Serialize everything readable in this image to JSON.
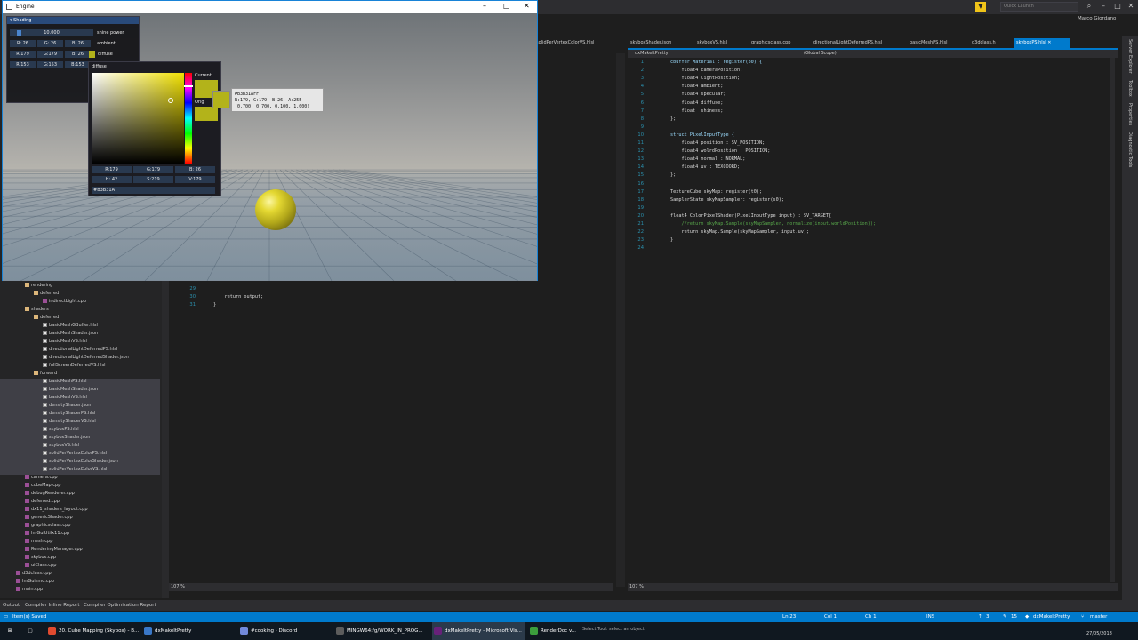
{
  "engine": {
    "title": "Engine",
    "imgui": {
      "window_title": "Shading",
      "shine_value": "10.000",
      "shine_label": "shine power",
      "ambient": {
        "r": "R: 26",
        "g": "G: 26",
        "b": "B: 26",
        "label": "ambient"
      },
      "diffuse": {
        "r": "R:179",
        "g": "G:179",
        "b": "B: 26",
        "label": "diffuse"
      },
      "specular": {
        "r": "R:153",
        "g": "G:153",
        "b": "B:153"
      },
      "picker": {
        "title": "diffuse",
        "current_label": "Current",
        "original_label": "Orig",
        "r": "R:179",
        "g": "G:179",
        "b": "B: 26",
        "h": "H: 42",
        "s": "S:219",
        "v": "V:179",
        "hex": "#B3B31A",
        "tooltip_line1": "#B3B31AFF",
        "tooltip_line2": "R:179, G:179, B:26, A:255",
        "tooltip_line3": "(0.700, 0.700, 0.100, 1.000)"
      }
    },
    "colors": {
      "diffuse": "#b3b31a",
      "ambient": "#1a1a1a",
      "specular": "#999999"
    }
  },
  "vs": {
    "quick_launch": "Quick Launch",
    "user": "Marco Giordano",
    "tabs_left": [
      "solidPerVertexColorVS.hlsl"
    ],
    "tabs_right": [
      "skyboxShader.json",
      "skyboxVS.hlsl",
      "graphicsclass.cpp",
      "directionalLightDeferredPS.hlsl",
      "basicMeshPS.hlsl",
      "d3dclass.h",
      "skyboxPS.hlsl"
    ],
    "nav_project": "dxMakeItPretty",
    "nav_scope": "(Global Scope)",
    "code_lines": [
      {
        "n": "1",
        "t": "cbuffer Material : register(b0) {"
      },
      {
        "n": "2",
        "t": "    float4 cameraPosition;"
      },
      {
        "n": "3",
        "t": "    float4 lightPosition;"
      },
      {
        "n": "4",
        "t": "    float4 ambient;"
      },
      {
        "n": "5",
        "t": "    float4 specular;"
      },
      {
        "n": "6",
        "t": "    float4 diffuse;"
      },
      {
        "n": "7",
        "t": "    float  shiness;"
      },
      {
        "n": "8",
        "t": "};"
      },
      {
        "n": "9",
        "t": ""
      },
      {
        "n": "10",
        "t": "struct PixelInputType {"
      },
      {
        "n": "11",
        "t": "    float4 position : SV_POSITION;"
      },
      {
        "n": "12",
        "t": "    float4 wolrdPosition : POSITION;"
      },
      {
        "n": "13",
        "t": "    float4 normal : NORMAL;"
      },
      {
        "n": "14",
        "t": "    float4 uv : TEXCOORD;"
      },
      {
        "n": "15",
        "t": "};"
      },
      {
        "n": "16",
        "t": ""
      },
      {
        "n": "17",
        "t": "TextureCube skyMap: register(t0);"
      },
      {
        "n": "18",
        "t": "SamplerState skyMapSampler: register(s0);"
      },
      {
        "n": "19",
        "t": ""
      },
      {
        "n": "20",
        "t": "float4 ColorPixelShader(PixelInputType input) : SV_TARGET{"
      },
      {
        "n": "21",
        "t": "    //return skyMap.Sample(skyMapSampler, normalize(input.worldPosition));"
      },
      {
        "n": "22",
        "t": "    return skyMap.Sample(skyMapSampler, input.uv);"
      },
      {
        "n": "23",
        "t": "}"
      },
      {
        "n": "24",
        "t": ""
      }
    ],
    "mid_lines": [
      {
        "n": "29",
        "t": ""
      },
      {
        "n": "30",
        "t": "    return output;"
      },
      {
        "n": "31",
        "t": "}"
      }
    ],
    "zoom_left": "107 %",
    "zoom_right": "107 %",
    "solution_tree": [
      {
        "label": "rendering",
        "kind": "folder",
        "level": 2
      },
      {
        "label": "deferred",
        "kind": "folder",
        "level": 3
      },
      {
        "label": "indirectLight.cpp",
        "kind": "cpp",
        "level": 4
      },
      {
        "label": "shaders",
        "kind": "folder",
        "level": 2
      },
      {
        "label": "deferred",
        "kind": "folder",
        "level": 3
      },
      {
        "label": "basicMeshGBuffer.hlsl",
        "kind": "file",
        "level": 4
      },
      {
        "label": "basicMeshShader.json",
        "kind": "file",
        "level": 4
      },
      {
        "label": "basicMeshVS.hlsl",
        "kind": "file",
        "level": 4
      },
      {
        "label": "directionalLightDeferredPS.hlsl",
        "kind": "file",
        "level": 4
      },
      {
        "label": "directionalLightDeferredShader.json",
        "kind": "file",
        "level": 4
      },
      {
        "label": "fullScreenDeferredVS.hlsl",
        "kind": "file",
        "level": 4
      },
      {
        "label": "forward",
        "kind": "folder",
        "level": 3
      },
      {
        "label": "basicMeshPS.hlsl",
        "kind": "file",
        "level": 4
      },
      {
        "label": "basicMeshShader.json",
        "kind": "file",
        "level": 4
      },
      {
        "label": "basicMeshVS.hlsl",
        "kind": "file",
        "level": 4
      },
      {
        "label": "densityShader.json",
        "kind": "file",
        "level": 4
      },
      {
        "label": "densityShaderPS.hlsl",
        "kind": "file",
        "level": 4
      },
      {
        "label": "densityShaderVS.hlsl",
        "kind": "file",
        "level": 4
      },
      {
        "label": "skyboxPS.hlsl",
        "kind": "file",
        "level": 4
      },
      {
        "label": "skyboxShader.json",
        "kind": "file",
        "level": 4
      },
      {
        "label": "skyboxVS.hlsl",
        "kind": "file",
        "level": 4
      },
      {
        "label": "solidPerVertexColorPS.hlsl",
        "kind": "file",
        "level": 4
      },
      {
        "label": "solidPerVertexColorShader.json",
        "kind": "file",
        "level": 4
      },
      {
        "label": "solidPerVertexColorVS.hlsl",
        "kind": "file",
        "level": 4
      },
      {
        "label": "camera.cpp",
        "kind": "cpp",
        "level": 2
      },
      {
        "label": "cubeMap.cpp",
        "kind": "cpp",
        "level": 2
      },
      {
        "label": "debugRenderer.cpp",
        "kind": "cpp",
        "level": 2
      },
      {
        "label": "deferred.cpp",
        "kind": "cpp",
        "level": 2
      },
      {
        "label": "dx11_shaders_layout.cpp",
        "kind": "cpp",
        "level": 2
      },
      {
        "label": "genericShader.cpp",
        "kind": "cpp",
        "level": 2
      },
      {
        "label": "graphicsclass.cpp",
        "kind": "cpp",
        "level": 2
      },
      {
        "label": "ImGuiUtilx11.cpp",
        "kind": "cpp",
        "level": 2
      },
      {
        "label": "mesh.cpp",
        "kind": "cpp",
        "level": 2
      },
      {
        "label": "RenderingManager.cpp",
        "kind": "cpp",
        "level": 2
      },
      {
        "label": "skybox.cpp",
        "kind": "cpp",
        "level": 2
      },
      {
        "label": "uiClass.cpp",
        "kind": "cpp",
        "level": 2
      },
      {
        "label": "d3dclass.cpp",
        "kind": "cpp",
        "level": 1
      },
      {
        "label": "ImGuizmo.cpp",
        "kind": "cpp",
        "level": 1
      },
      {
        "label": "main.cpp",
        "kind": "cpp",
        "level": 1
      }
    ],
    "right_strip": [
      "Server Explorer",
      "Toolbox",
      "Properties",
      "Diagnostic Tools"
    ],
    "output_tabs": [
      "Output",
      "Compiler Inline Report",
      "Compiler Optimization Report"
    ],
    "status": {
      "msg": "Item(s) Saved",
      "ln": "Ln 23",
      "col": "Col 1",
      "ch": "Ch 1",
      "ins": "INS",
      "up": "3",
      "edits": "15",
      "project": "dxMakeItPretty",
      "branch": "master"
    }
  },
  "taskbar": {
    "items": [
      {
        "label": "20. Cube Mapping (Skybox) - B...",
        "color": "#e04a2f"
      },
      {
        "label": "dxMakeItPretty",
        "color": "#3a78c8"
      },
      {
        "label": "#cooking - Discord",
        "color": "#7289da"
      },
      {
        "label": "MINGW64:/g/WORK_IN_PROG...",
        "color": "#5c5c5c"
      },
      {
        "label": "dxMakeItPretty - Microsoft Vis...",
        "color": "#68217a"
      },
      {
        "label": "RenderDoc v...",
        "color": "#3c9e3c"
      }
    ],
    "tooltip": "Select Tool: select an object",
    "clock_date": "27/05/2018"
  }
}
